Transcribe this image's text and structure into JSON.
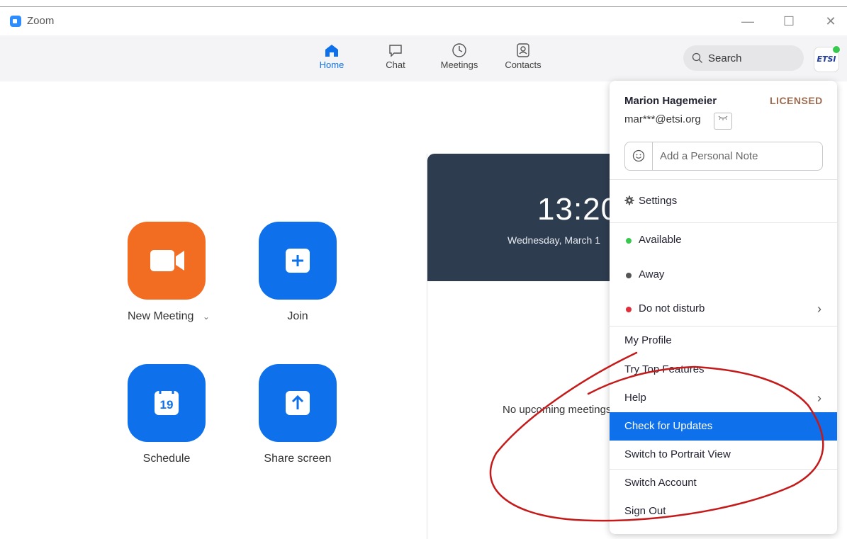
{
  "window": {
    "title": "Zoom",
    "minimize": "—",
    "maximize": "☐",
    "close": "✕"
  },
  "nav": {
    "home": "Home",
    "chat": "Chat",
    "meetings": "Meetings",
    "contacts": "Contacts",
    "search": "Search",
    "avatar": "ETSI"
  },
  "actions": {
    "new_meeting": "New Meeting",
    "new_meeting_caret": "⌄",
    "join": "Join",
    "schedule": "Schedule",
    "schedule_day": "19",
    "share_screen": "Share screen"
  },
  "meeting_card": {
    "time": "13:20",
    "date": "Wednesday, March 1",
    "empty": "No upcoming meetings"
  },
  "menu": {
    "user_name": "Marion Hagemeier",
    "license": "LICENSED",
    "email": "mar***@etsi.org",
    "note_placeholder": "Add a Personal Note",
    "settings": "Settings",
    "available": "Available",
    "away": "Away",
    "dnd": "Do not disturb",
    "my_profile": "My Profile",
    "top_features": "Try Top Features",
    "help": "Help",
    "check_updates": "Check for Updates",
    "portrait": "Switch to Portrait View",
    "switch_account": "Switch Account",
    "sign_out": "Sign Out"
  },
  "colors": {
    "accent": "#0e71eb",
    "orange": "#f26d21",
    "available": "#37c94e",
    "dnd": "#e02f3b",
    "annotation": "#c41a1a"
  }
}
